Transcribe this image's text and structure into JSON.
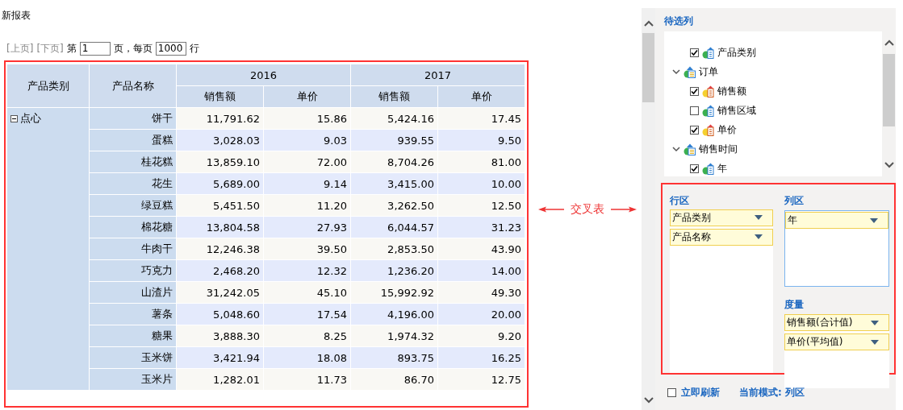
{
  "report_title": "新报表",
  "pager": {
    "prev": "[上页]",
    "next": "[下页]",
    "page_label": "第",
    "page": "1",
    "per_page_label": "页，每页",
    "per_page": "1000",
    "rows_label": "行"
  },
  "table": {
    "row_headers": [
      "产品类别",
      "产品名称"
    ],
    "column_groups": [
      {
        "label": "2016",
        "columns": [
          "销售额",
          "单价"
        ]
      },
      {
        "label": "2017",
        "columns": [
          "销售额",
          "单价"
        ]
      }
    ],
    "groups": [
      {
        "label": "点心",
        "expanded": true,
        "rows": [
          {
            "name": "饼干",
            "values": [
              "11,791.62",
              "15.86",
              "5,424.16",
              "17.45"
            ]
          },
          {
            "name": "蛋糕",
            "values": [
              "3,028.03",
              "9.03",
              "939.55",
              "9.50"
            ]
          },
          {
            "name": "桂花糕",
            "values": [
              "13,859.10",
              "72.00",
              "8,704.26",
              "81.00"
            ]
          },
          {
            "name": "花生",
            "values": [
              "5,689.00",
              "9.14",
              "3,415.00",
              "10.00"
            ]
          },
          {
            "name": "绿豆糕",
            "values": [
              "5,451.50",
              "11.20",
              "3,262.50",
              "12.50"
            ]
          },
          {
            "name": "棉花糖",
            "values": [
              "13,804.58",
              "27.93",
              "6,044.57",
              "31.23"
            ]
          },
          {
            "name": "牛肉干",
            "values": [
              "12,246.38",
              "39.50",
              "2,853.50",
              "43.90"
            ]
          },
          {
            "name": "巧克力",
            "values": [
              "2,468.20",
              "12.32",
              "1,236.20",
              "14.00"
            ]
          },
          {
            "name": "山渣片",
            "values": [
              "31,242.05",
              "45.10",
              "15,992.92",
              "49.30"
            ]
          },
          {
            "name": "薯条",
            "values": [
              "5,048.60",
              "17.54",
              "4,196.00",
              "20.00"
            ]
          },
          {
            "name": "糖果",
            "values": [
              "3,888.30",
              "8.25",
              "1,974.32",
              "9.20"
            ]
          },
          {
            "name": "玉米饼",
            "values": [
              "3,421.94",
              "18.08",
              "893.75",
              "16.25"
            ]
          },
          {
            "name": "玉米片",
            "values": [
              "1,282.01",
              "11.73",
              "86.70",
              "12.75"
            ]
          }
        ]
      }
    ]
  },
  "annotation": {
    "label": "交叉表"
  },
  "field_panel": {
    "title": "待选列",
    "tree": [
      {
        "label": "产品类别",
        "kind": "dimension",
        "checked": true
      },
      {
        "label": "订单",
        "kind": "table",
        "expanded": true,
        "children": [
          {
            "label": "销售额",
            "kind": "measure",
            "checked": true
          },
          {
            "label": "销售区域",
            "kind": "dimension",
            "checked": false
          },
          {
            "label": "单价",
            "kind": "measure",
            "checked": true
          }
        ]
      },
      {
        "label": "销售时间",
        "kind": "table",
        "expanded": true,
        "children": [
          {
            "label": "年",
            "kind": "dimension",
            "checked": true
          }
        ]
      }
    ],
    "row_area": {
      "title": "行区",
      "items": [
        "产品类别",
        "产品名称"
      ]
    },
    "column_area": {
      "title": "列区",
      "items": [
        "年"
      ]
    },
    "measure_area": {
      "title": "度量",
      "items": [
        "销售额(合计值)",
        "单价(平均值)"
      ]
    },
    "auto_refresh": {
      "label": "立即刷新",
      "checked": false
    },
    "mode": {
      "label": "当前模式:",
      "value": "列区"
    }
  }
}
